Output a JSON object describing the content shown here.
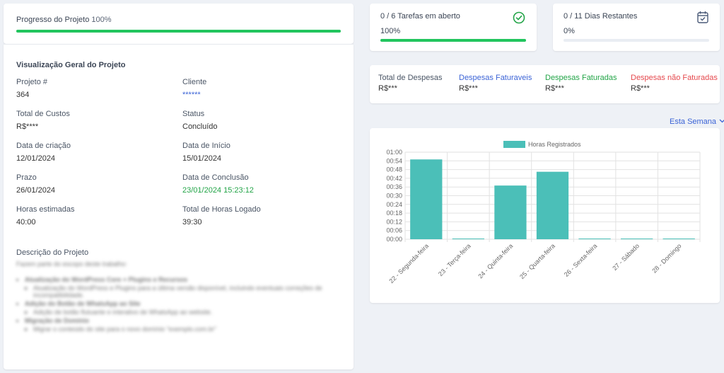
{
  "progress": {
    "label": "Progresso do Projeto",
    "percent_text": "100%",
    "value": 1.0
  },
  "overview": {
    "title": "Visualização Geral do Projeto",
    "fields": [
      {
        "label": "Projeto #",
        "value": "364"
      },
      {
        "label": "Cliente",
        "value": "******"
      },
      {
        "label": "Total de Custos",
        "value": "R$****"
      },
      {
        "label": "Status",
        "value": "Concluído"
      },
      {
        "label": "Data de criação",
        "value": "12/01/2024"
      },
      {
        "label": "Data de Início",
        "value": "15/01/2024"
      },
      {
        "label": "Prazo",
        "value": "26/01/2024"
      },
      {
        "label": "Data de Conclusão",
        "value": "23/01/2024 15:23:12"
      },
      {
        "label": "Horas estimadas",
        "value": "40:00"
      },
      {
        "label": "Total de Horas Logado",
        "value": "39:30"
      }
    ],
    "description_label": "Descrição do Projeto",
    "description_blurred": [
      "Fazem parte do escopo deste trabalho:",
      "Atualização do WordPress Core + Plugins e Recursos",
      "Atualização do WordPress e Plugins para a última versão disponível, incluindo eventuais correções de incompatibilidade.",
      "Adição do Botão de WhatsApp ao Site",
      "Adição de botão flutuante e interativo de WhatsApp ao website.",
      "Migração de Domínio",
      "Migrar o conteúdo do site para o novo domínio \"exemplo.com.br\""
    ]
  },
  "tasks": {
    "label": "0 / 6 Tarefas em aberto",
    "percent_text": "100%",
    "value": 1.0,
    "icon": "check-circle-icon",
    "color": "#22a447"
  },
  "days": {
    "label": "0 / 11 Dias Restantes",
    "percent_text": "0%",
    "value": 0.0,
    "icon": "calendar-check-icon"
  },
  "expenses": [
    {
      "label": "Total de Despesas",
      "value": "R$***",
      "color": "#4a5565"
    },
    {
      "label": "Despesas Faturaveis",
      "value": "R$***",
      "color": "#3b63d6"
    },
    {
      "label": "Despesas Faturadas",
      "value": "R$***",
      "color": "#22a447"
    },
    {
      "label": "Despesas não Faturadas",
      "value": "R$***",
      "color": "#e5484d"
    }
  ],
  "week_filter": {
    "label": "Esta Semana",
    "icon": "chevron-down-icon"
  },
  "chart_data": {
    "type": "bar",
    "legend": [
      "Horas Registrados"
    ],
    "color": "#4bbfb8",
    "categories": [
      "22 - Segunda-feira",
      "23 - Terça-feira",
      "24 - Quinta-feira",
      "25 - Quarta-feira",
      "26 - Sexta-feira",
      "27 - Sábado",
      "28 - Domingo"
    ],
    "values_minutes": [
      55,
      0,
      37,
      46.5,
      0,
      0,
      0
    ],
    "y_ticks": [
      "00:00",
      "00:06",
      "00:12",
      "00:18",
      "00:24",
      "00:30",
      "00:36",
      "00:42",
      "00:48",
      "00:54",
      "01:00"
    ],
    "ylim_minutes": [
      0,
      60
    ],
    "grid": true,
    "legend_position": "top"
  }
}
